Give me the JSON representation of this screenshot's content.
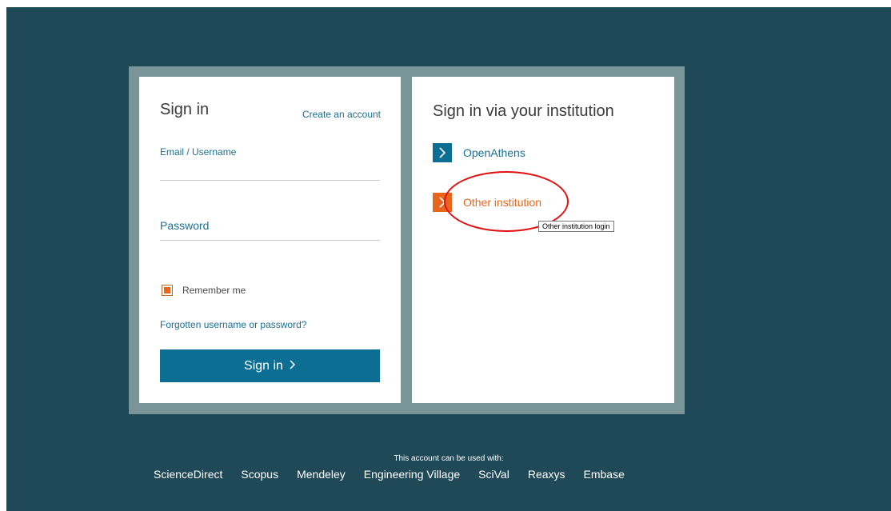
{
  "signin": {
    "title": "Sign in",
    "create_account": "Create an account",
    "email_label": "Email / Username",
    "email_value": "",
    "password_label": "Password",
    "password_value": "",
    "remember_label": "Remember me",
    "remember_checked": true,
    "forgot_link": "Forgotten username or password?",
    "submit_label": "Sign in",
    "submit_icon": "chevron-right-icon"
  },
  "institution": {
    "title": "Sign in via your institution",
    "options": [
      {
        "label": "OpenAthens",
        "icon": "chevron-right-icon",
        "color": "#0d6e93"
      },
      {
        "label": "Other institution",
        "icon": "chevron-right-icon",
        "color": "#e8661c"
      }
    ],
    "tooltip": "Other institution login"
  },
  "footer": {
    "caption": "This account can be used with:",
    "products": [
      "ScienceDirect",
      "Scopus",
      "Mendeley",
      "Engineering Village",
      "SciVal",
      "Reaxys",
      "Embase"
    ]
  },
  "colors": {
    "background": "#1f4956",
    "frame": "#7a9597",
    "accent_blue": "#0d6e93",
    "accent_orange": "#e8661c",
    "annotation_red": "#e21010"
  }
}
